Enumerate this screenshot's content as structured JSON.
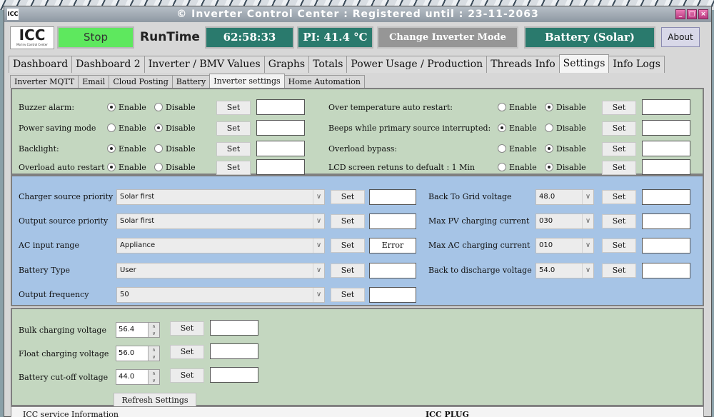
{
  "window": {
    "title": "© Inverter Control Center : Registered until : 23-11-2063",
    "logo_small": "ICC",
    "buttons": [
      "_",
      "□",
      "×"
    ]
  },
  "toolbar": {
    "logo": "ICC",
    "logo_sub": "Mo Inv Control Center",
    "stop_label": "Stop",
    "runtime_label": "RunTime",
    "runtime_value": "62:58:33",
    "pi_temp": "PI: 41.4 °C",
    "change_mode": "Change Inverter Mode",
    "battery_mode": "Battery (Solar)",
    "about": "About"
  },
  "main_tabs": [
    "Dashboard",
    "Dashboard 2",
    "Inverter / BMV Values",
    "Graphs",
    "Totals",
    "Power Usage / Production",
    "Threads Info",
    "Settings",
    "Info Logs"
  ],
  "active_main_tab": "Settings",
  "sub_tabs": [
    "Inverter  MQTT",
    "Email",
    "Cloud Posting",
    "Battery",
    "Inverter settings",
    "Home Automation"
  ],
  "active_sub_tab": "Inverter settings",
  "enable_label": "Enable",
  "disable_label": "Disable",
  "set_label": "Set",
  "toggles_left": [
    {
      "label": "Buzzer alarm:",
      "selected": "Enable",
      "field": ""
    },
    {
      "label": "Power saving mode",
      "selected": "Disable",
      "field": ""
    },
    {
      "label": "Backlight:",
      "selected": "Enable",
      "field": ""
    },
    {
      "label": "Overload auto restart",
      "selected": "Enable",
      "field": ""
    }
  ],
  "toggles_right": [
    {
      "label": "Over temperature auto restart:",
      "selected": "Disable",
      "field": ""
    },
    {
      "label": "Beeps while primary source interrupted:",
      "selected": "Enable",
      "field": ""
    },
    {
      "label": "Overload bypass:",
      "selected": "Disable",
      "field": ""
    },
    {
      "label": "LCD screen retuns to defualt : 1 Min",
      "selected": "Disable",
      "field": ""
    }
  ],
  "selects_left": [
    {
      "label": "Charger source priority",
      "value": "Solar first",
      "field": ""
    },
    {
      "label": "Output source priority",
      "value": "Solar first",
      "field": ""
    },
    {
      "label": "AC input range",
      "value": "Appliance",
      "field": "Error"
    },
    {
      "label": "Battery Type",
      "value": "User",
      "field": ""
    },
    {
      "label": "Output frequency",
      "value": "50",
      "field": ""
    }
  ],
  "selects_right": [
    {
      "label": "Back To Grid voltage",
      "value": "48.0",
      "field": ""
    },
    {
      "label": "Max PV charging current",
      "value": "030",
      "field": ""
    },
    {
      "label": "Max AC charging current",
      "value": "010",
      "field": ""
    },
    {
      "label": "Back to discharge voltage",
      "value": "54.0",
      "field": ""
    }
  ],
  "voltages": [
    {
      "label": "Bulk charging voltage",
      "value": "56.4",
      "field": ""
    },
    {
      "label": "Float charging voltage",
      "value": "56.0",
      "field": ""
    },
    {
      "label": "Battery cut-off voltage",
      "value": "44.0",
      "field": ""
    }
  ],
  "refresh_label": "Refresh Settings",
  "footer": {
    "left": "ICC service Information",
    "right": "ICC PLUG"
  }
}
